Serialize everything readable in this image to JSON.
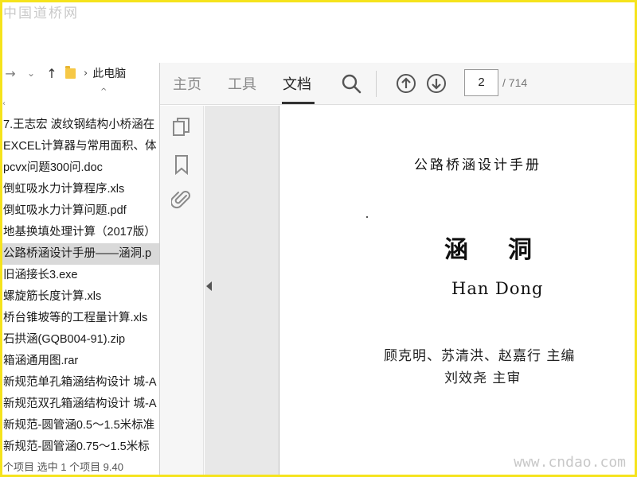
{
  "watermarks": {
    "top": "中国道桥网",
    "bottom": "www.cndao.com"
  },
  "explorer": {
    "nav": {
      "back_icon": "back-arrow-icon",
      "recent_icon": "chevron-down-icon",
      "up_icon": "up-arrow-icon",
      "breadcrumb_separator": "›",
      "breadcrumb": "此电脑"
    },
    "sort_caret": "^",
    "left_mark": "‹",
    "files": [
      "7.王志宏 波纹钢结构小桥涵在",
      "EXCEL计算器与常用面积、体",
      "pcvx问题300问.doc",
      "倒虹吸水力计算程序.xls",
      "倒虹吸水力计算问题.pdf",
      "地基换填处理计算（2017版）",
      "公路桥涵设计手册——涵洞.p",
      "旧涵接长3.exe",
      "螺旋筋长度计算.xls",
      "桥台锥坡等的工程量计算.xls",
      "石拱涵(GQB004-91).zip",
      "箱涵通用图.rar",
      "新规范单孔箱涵结构设计 城-A",
      "新规范双孔箱涵结构设计 城-A",
      "新规范-圆管涵0.5～1.5米标准",
      "新规范-圆管涵0.75～1.5米标"
    ],
    "selected_index": 6,
    "status": "个项目    选中 1 个项目  9.40"
  },
  "viewer": {
    "tabs": [
      "主页",
      "工具",
      "文档"
    ],
    "active_tab": 2,
    "page_current": "2",
    "page_total": "/ 714",
    "icons": {
      "search": "search-icon",
      "prev": "arrow-up-circle-icon",
      "next": "arrow-down-circle-icon",
      "pages": "pages-copy-icon",
      "bookmark": "bookmark-icon",
      "attachment": "paperclip-icon",
      "collapse": "collapse-left-icon"
    },
    "document": {
      "series": "公路桥涵设计手册",
      "title": "涵洞",
      "subtitle": "Han Dong",
      "editors": "顾克明、苏清洪、赵嘉行  主编",
      "reviewer": "刘效尧  主审"
    }
  },
  "colors": {
    "frame": "#f5e31c",
    "toolbar_bg": "#f6f6f6",
    "selected_row": "#d9d9d9",
    "gutter_bg": "#e8e8e8"
  }
}
